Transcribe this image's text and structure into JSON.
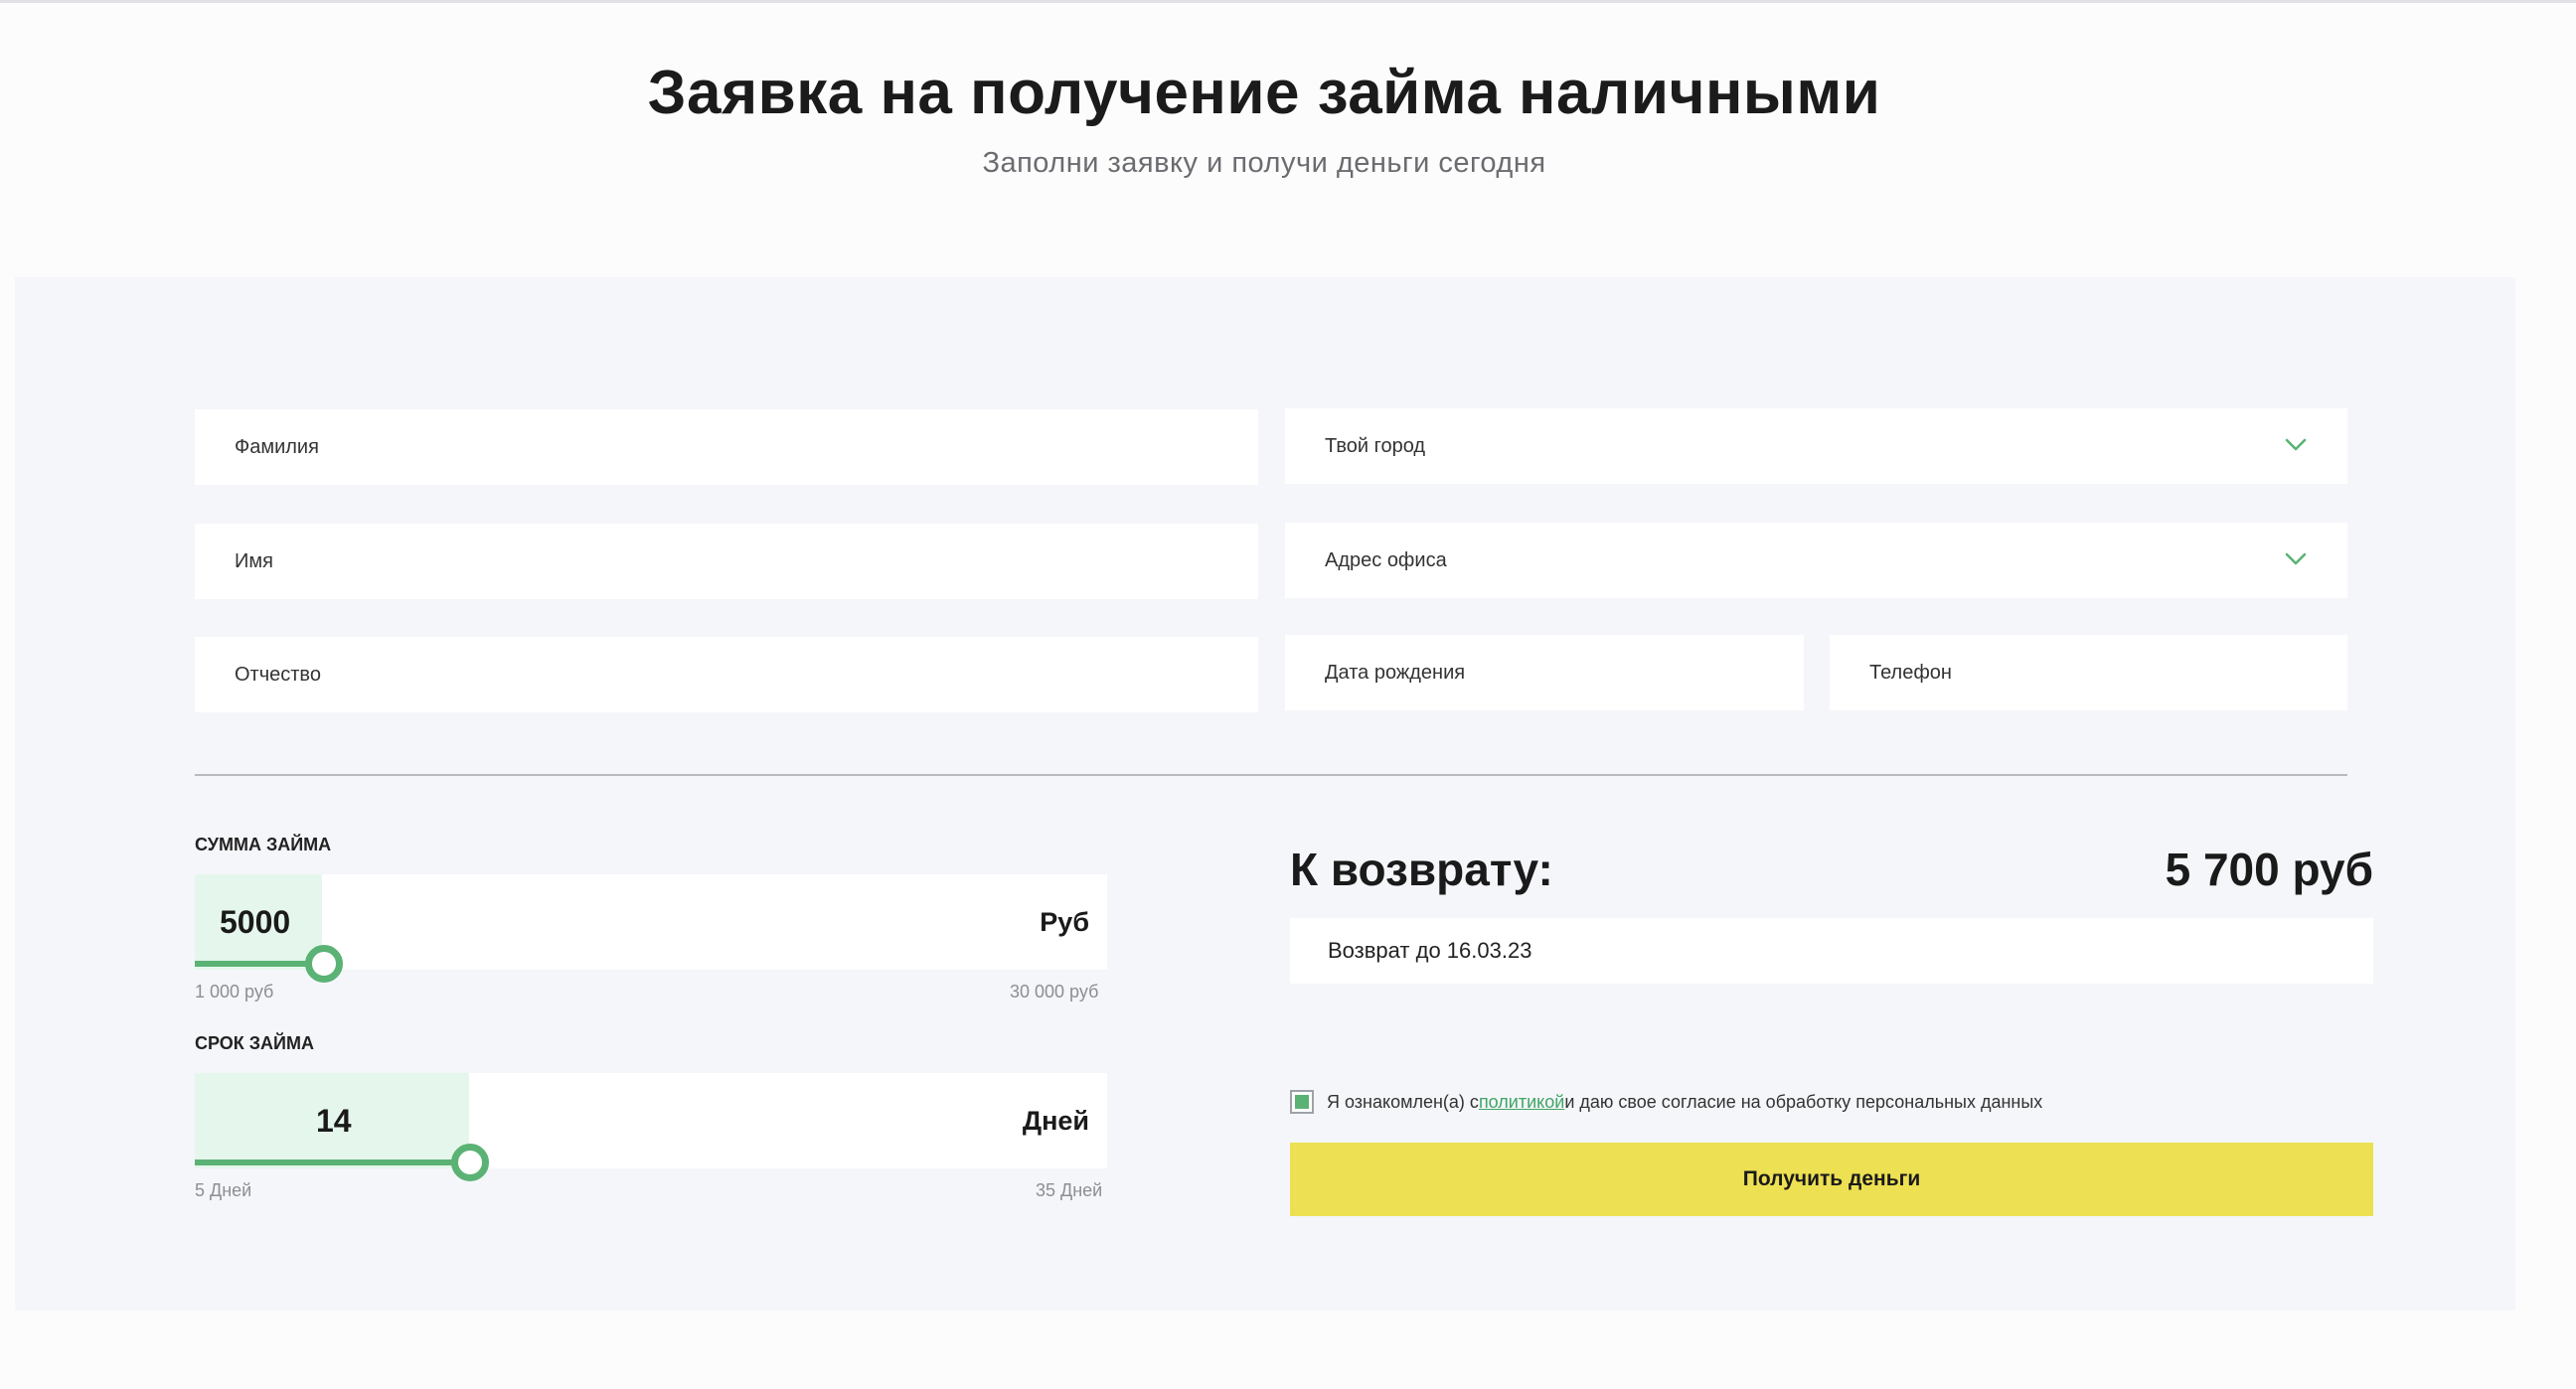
{
  "header": {
    "title": "Заявка на получение займа наличными",
    "subtitle": "Заполни заявку и получи деньги сегодня"
  },
  "form": {
    "lastname_placeholder": "Фамилия",
    "firstname_placeholder": "Имя",
    "patronymic_placeholder": "Отчество",
    "city_placeholder": "Твой город",
    "office_placeholder": "Адрес офиса",
    "birthdate_placeholder": "Дата рождения",
    "phone_placeholder": "Телефон"
  },
  "amount": {
    "label": "СУММА ЗАЙМА",
    "value": "5000",
    "unit": "Руб",
    "min_label": "1 000 руб",
    "max_label": "30 000 руб"
  },
  "term": {
    "label": "СРОК ЗАЙМА",
    "value": "14",
    "unit": "Дней",
    "min_label": "5 Дней",
    "max_label": "35 Дней"
  },
  "summary": {
    "title": "К возврату:",
    "amount": "5 700 руб",
    "return_date": "Возврат до 16.03.23"
  },
  "consent": {
    "checked": true,
    "text_before": "Я ознакомлен(а) с ",
    "link_text": "политикой ",
    "text_after": "и даю свое согласие на обработку персональных данных"
  },
  "submit_label": "Получить деньги",
  "colors": {
    "accent_green": "#5bb275",
    "button_yellow": "#ede052",
    "panel_bg": "#f5f6fa"
  }
}
